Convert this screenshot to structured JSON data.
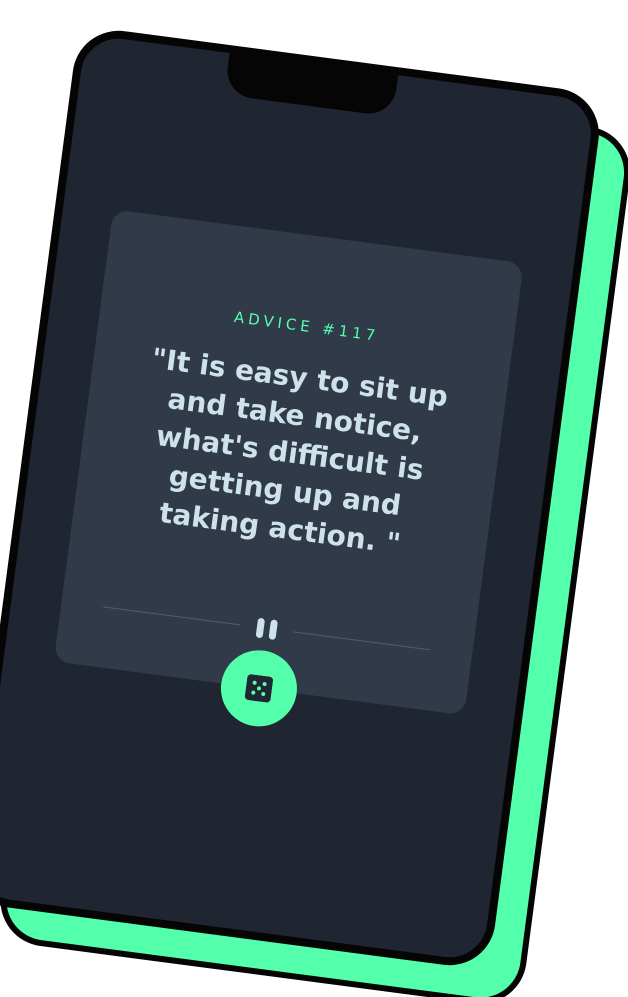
{
  "advice": {
    "id_label": "ADVICE #117",
    "text": "\"It is easy to sit up and take notice, what's difficult is getting up and taking action. \""
  },
  "icons": {
    "divider": "pause-icon",
    "generate": "dice-icon"
  },
  "colors": {
    "accent": "#53ffab",
    "card": "#313a48",
    "background": "#1f2631",
    "text": "#cee3e9",
    "divider": "#4f5d74"
  }
}
